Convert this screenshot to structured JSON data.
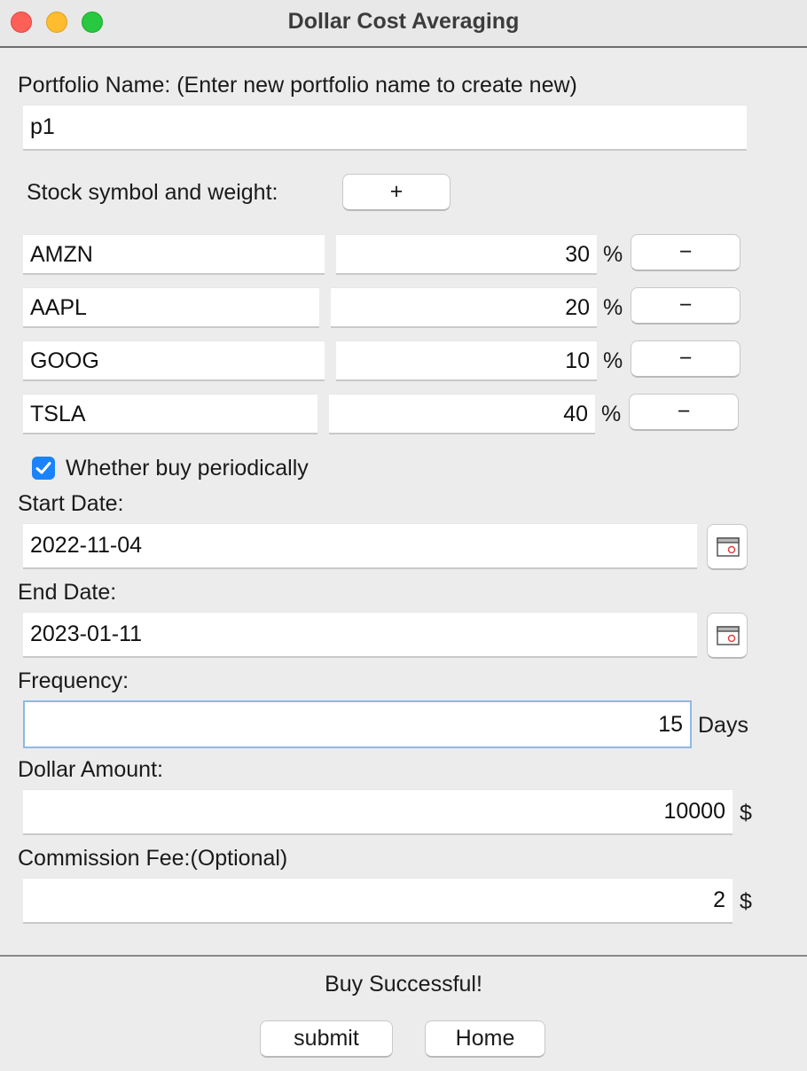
{
  "window": {
    "title": "Dollar Cost Averaging"
  },
  "portfolio": {
    "label": "Portfolio Name: (Enter new portfolio name to create new)",
    "value": "p1"
  },
  "stocks": {
    "label": "Stock symbol and weight:",
    "add_label": "+",
    "remove_label": "−",
    "percent_sign": "%",
    "rows": [
      {
        "symbol": "AMZN",
        "weight": "30"
      },
      {
        "symbol": "AAPL",
        "weight": "20"
      },
      {
        "symbol": "GOOG",
        "weight": "10"
      },
      {
        "symbol": "TSLA",
        "weight": "40"
      }
    ]
  },
  "periodic": {
    "label": "Whether buy periodically",
    "checked": true
  },
  "start_date": {
    "label": "Start Date:",
    "value": "2022-11-04"
  },
  "end_date": {
    "label": "End Date:",
    "value": "2023-01-11"
  },
  "frequency": {
    "label": "Frequency:",
    "value": "15",
    "unit": "Days"
  },
  "dollar_amount": {
    "label": "Dollar Amount:",
    "value": "10000",
    "unit": "$"
  },
  "commission": {
    "label": "Commission Fee:(Optional)",
    "value": "2",
    "unit": "$"
  },
  "status": {
    "message": "Buy Successful!"
  },
  "actions": {
    "submit": "submit",
    "home": "Home"
  },
  "icons": {
    "calendar": "calendar-icon",
    "check": "checkmark-icon"
  },
  "colors": {
    "accent": "#1a82fb",
    "focus": "#8fb8e6"
  }
}
